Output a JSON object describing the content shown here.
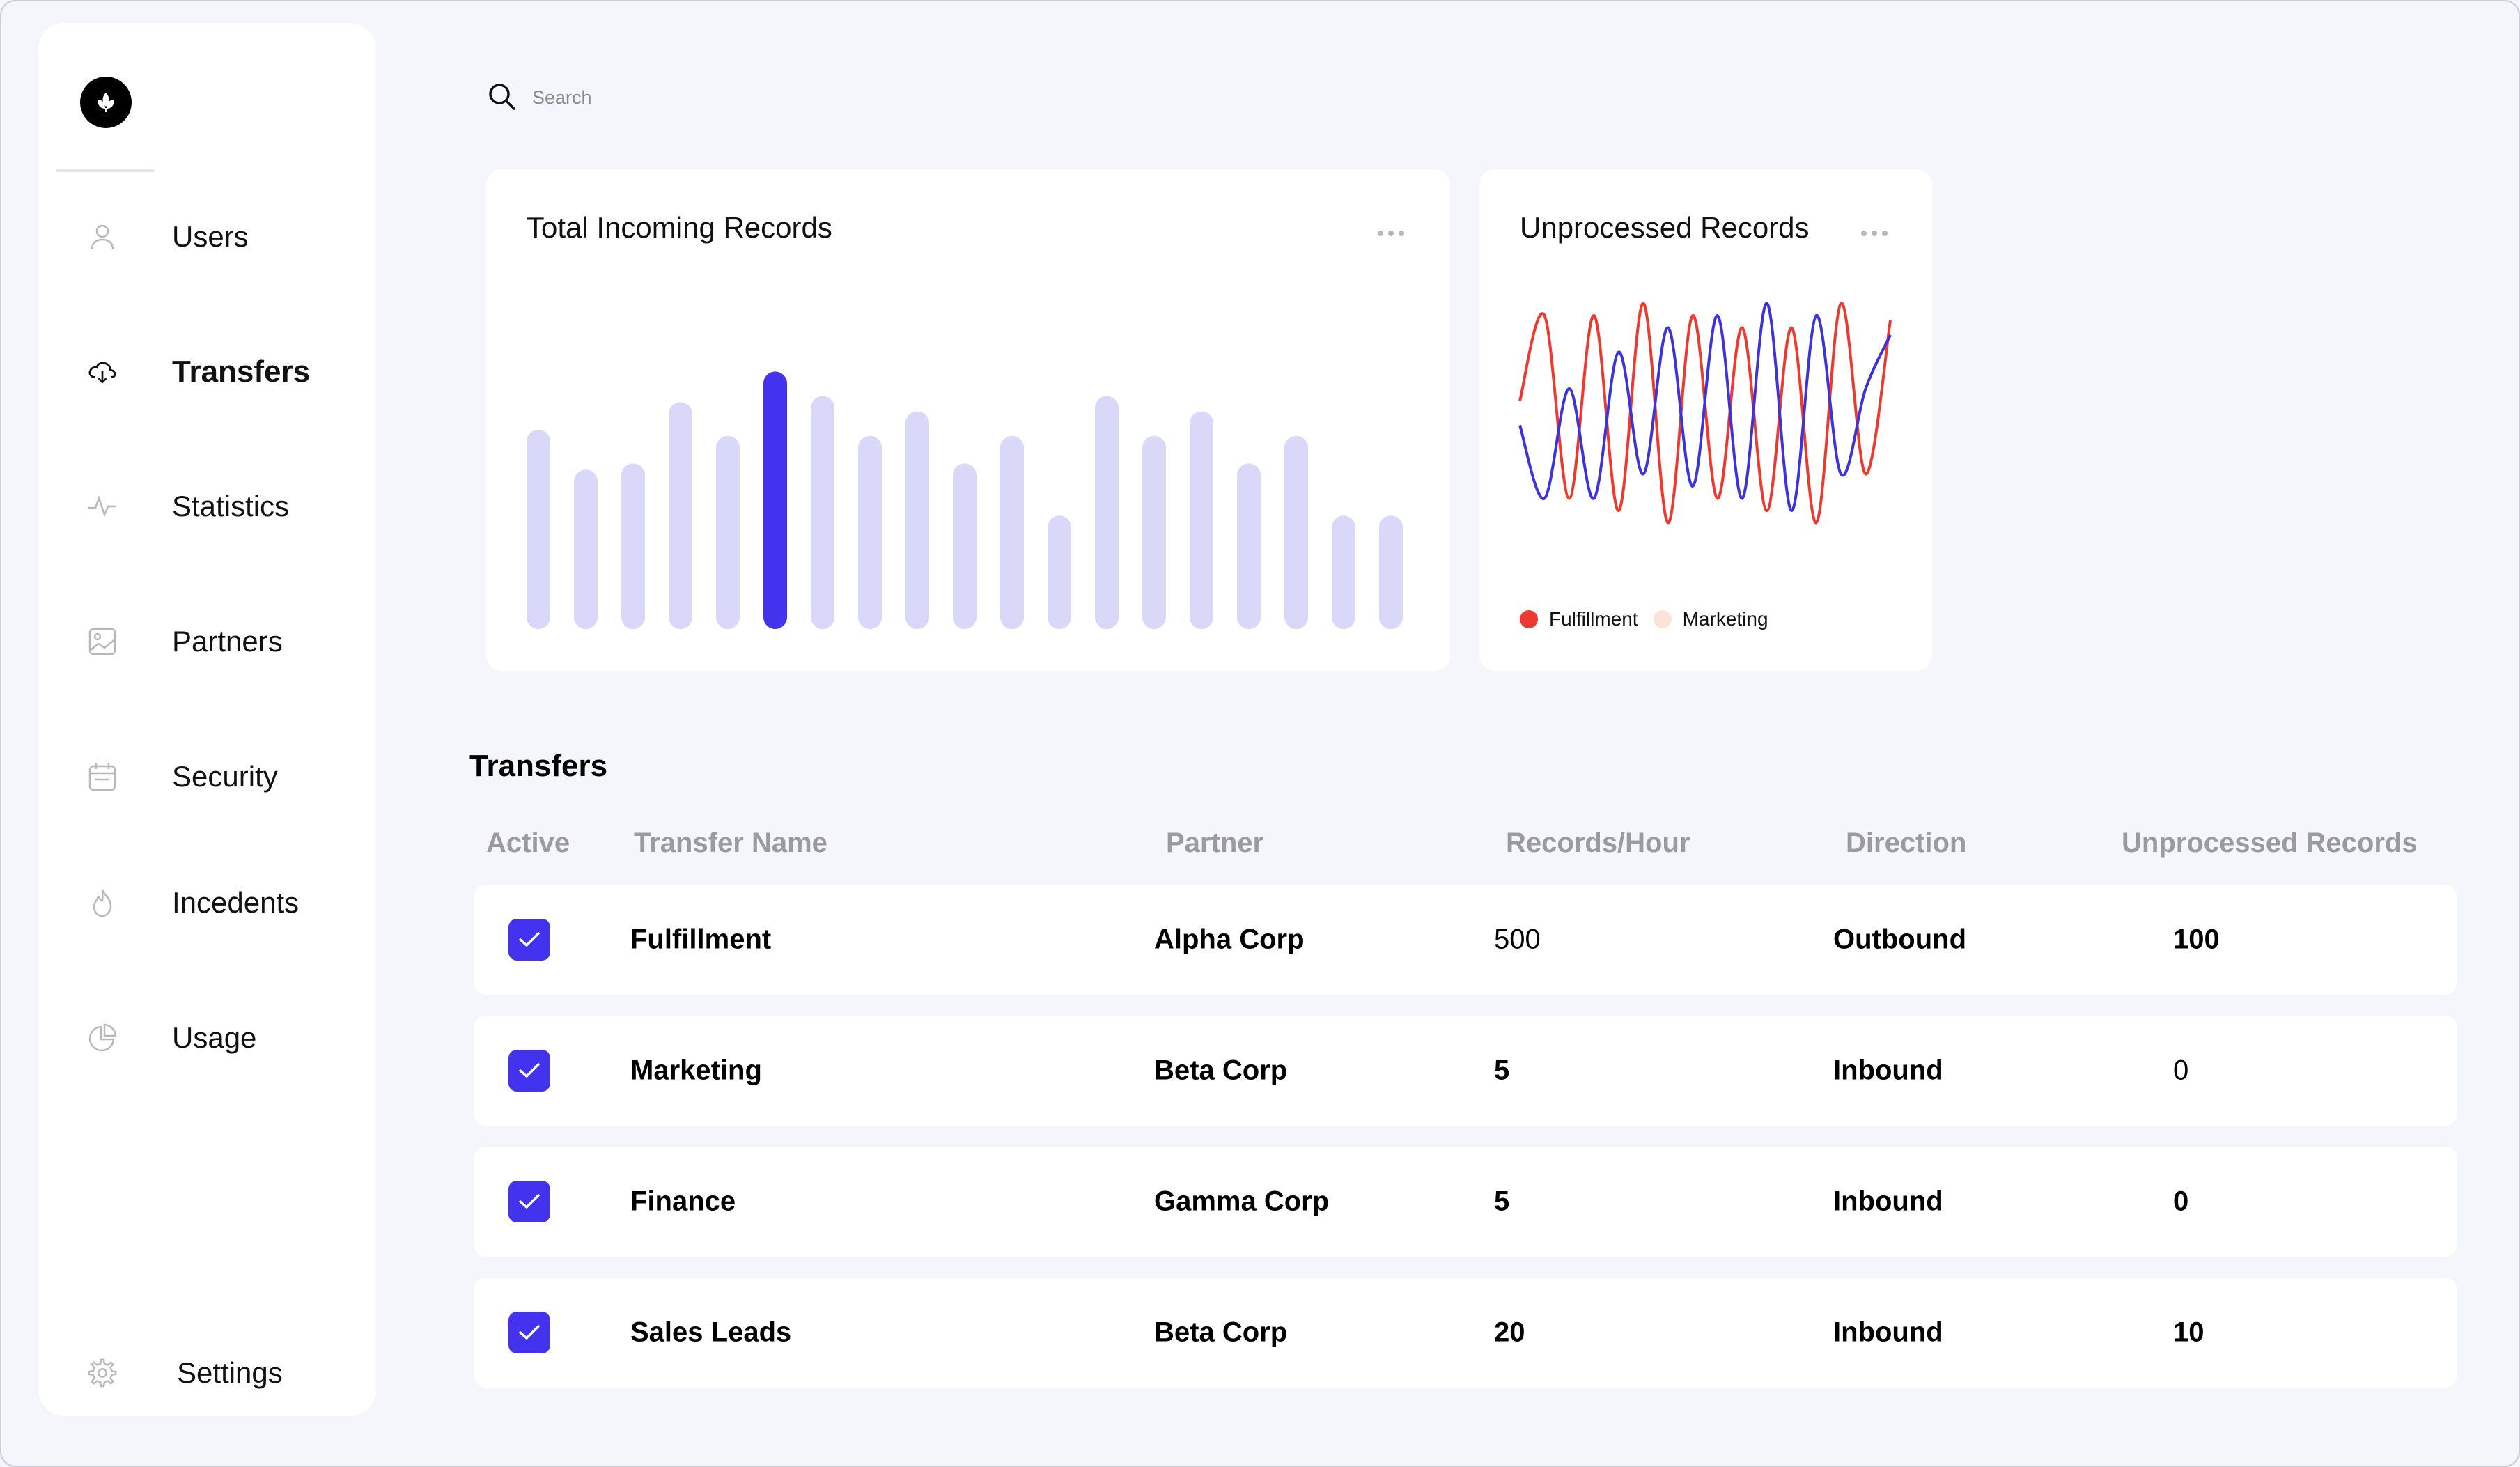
{
  "sidebar": {
    "items": [
      {
        "label": "Users",
        "icon": "user-icon"
      },
      {
        "label": "Transfers",
        "icon": "cloud-download-icon",
        "active": true
      },
      {
        "label": "Statistics",
        "icon": "activity-icon"
      },
      {
        "label": "Partners",
        "icon": "image-icon"
      },
      {
        "label": "Security",
        "icon": "calendar-icon"
      },
      {
        "label": "Incedents",
        "icon": "flame-icon"
      },
      {
        "label": "Usage",
        "icon": "pie-chart-icon"
      }
    ],
    "settings_label": "Settings"
  },
  "search": {
    "placeholder": "Search"
  },
  "cards": {
    "incoming_title": "Total Incoming Records",
    "unprocessed_title": "Unprocessed Records",
    "legend": [
      "Fulfillment",
      "Marketing"
    ]
  },
  "colors": {
    "accent": "#4433ee",
    "bar_muted": "#d9d8f8",
    "fulfillment": "#ee3a2e",
    "marketing_legend": "#fbe3d6",
    "marketing_line": "#3d33dd"
  },
  "chart_data": [
    {
      "type": "bar",
      "title": "Total Incoming Records",
      "values": [
        65,
        52,
        54,
        74,
        63,
        84,
        76,
        63,
        71,
        54,
        63,
        37,
        76,
        63,
        71,
        54,
        63,
        37,
        37
      ],
      "highlight_index": 5,
      "ylim": [
        0,
        100
      ]
    },
    {
      "type": "line",
      "title": "Unprocessed Records",
      "series": [
        {
          "name": "Fulfillment",
          "values": [
            0.55,
            0.9,
            0.15,
            0.9,
            0.1,
            0.95,
            0.05,
            0.9,
            0.15,
            0.85,
            0.1,
            0.85,
            0.05,
            0.95,
            0.25,
            0.88
          ]
        },
        {
          "name": "Marketing",
          "values": [
            0.45,
            0.15,
            0.6,
            0.15,
            0.75,
            0.25,
            0.85,
            0.2,
            0.9,
            0.15,
            0.95,
            0.1,
            0.9,
            0.25,
            0.6,
            0.82
          ]
        }
      ],
      "legend": "bottom-left"
    }
  ],
  "table": {
    "title": "Transfers",
    "columns": [
      "Active",
      "Transfer Name",
      "Partner",
      "Records/Hour",
      "Direction",
      "Unprocessed Records"
    ],
    "rows": [
      {
        "active": true,
        "name": "Fulfillment",
        "partner": "Alpha Corp",
        "records": "500",
        "direction": "Outbound",
        "unprocessed": "100",
        "records_bold": false,
        "unprocessed_bold": true
      },
      {
        "active": true,
        "name": "Marketing",
        "partner": "Beta Corp",
        "records": "5",
        "direction": "Inbound",
        "unprocessed": "0",
        "records_bold": true,
        "unprocessed_bold": false
      },
      {
        "active": true,
        "name": "Finance",
        "partner": "Gamma Corp",
        "records": "5",
        "direction": "Inbound",
        "unprocessed": "0",
        "records_bold": true,
        "unprocessed_bold": true
      },
      {
        "active": true,
        "name": "Sales Leads",
        "partner": "Beta Corp",
        "records": "20",
        "direction": "Inbound",
        "unprocessed": "10",
        "records_bold": true,
        "unprocessed_bold": true
      }
    ]
  }
}
